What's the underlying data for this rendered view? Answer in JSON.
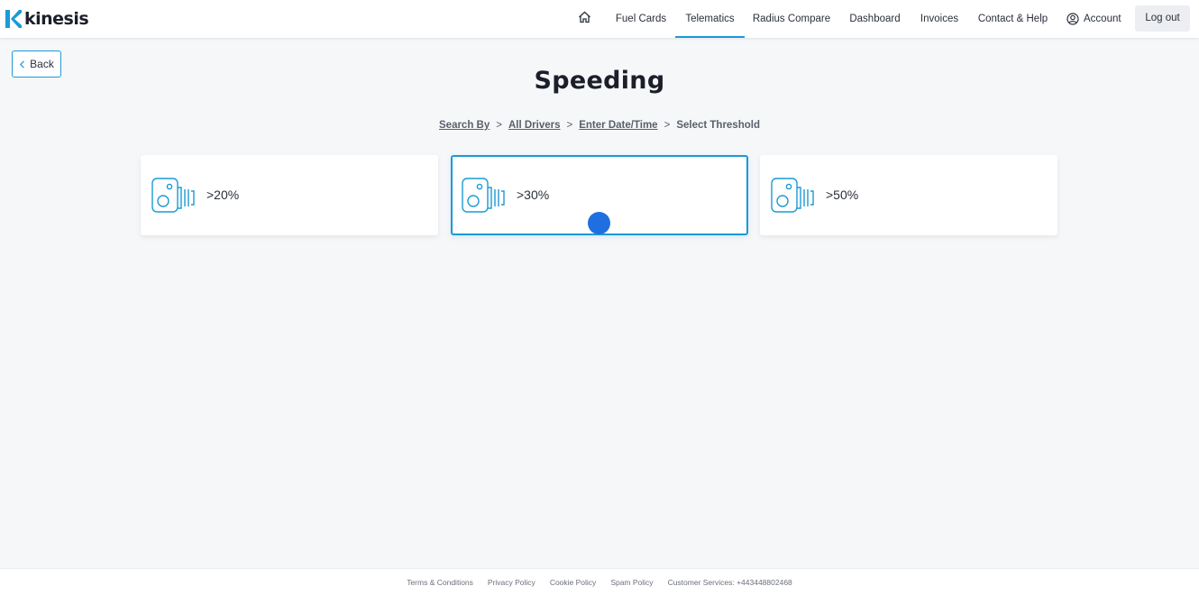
{
  "brand": {
    "name": "kinesis",
    "accent": "#1b9ad6"
  },
  "nav": {
    "home_icon": "home-icon",
    "items": [
      {
        "label": "Fuel Cards"
      },
      {
        "label": "Telematics",
        "active": true
      },
      {
        "label": "Radius Compare"
      },
      {
        "label": "Dashboard"
      },
      {
        "label": "Invoices"
      },
      {
        "label": "Contact & Help"
      }
    ],
    "account_label": "Account",
    "logout_label": "Log out"
  },
  "back_label": "Back",
  "page_title": "Speeding",
  "breadcrumb": {
    "items": [
      "Search By",
      "All Drivers",
      "Enter Date/Time"
    ],
    "separator": ">",
    "current": "Select Threshold"
  },
  "thresholds": [
    {
      "label": ">20%",
      "icon": "speed-camera-icon",
      "selected": false
    },
    {
      "label": ">30%",
      "icon": "speed-camera-icon",
      "selected": true
    },
    {
      "label": ">50%",
      "icon": "speed-camera-icon",
      "selected": false
    }
  ],
  "footer": {
    "links": [
      "Terms & Conditions",
      "Privacy Policy",
      "Cookie Policy",
      "Spam Policy"
    ],
    "customer_services": "Customer Services: +443448802468"
  }
}
